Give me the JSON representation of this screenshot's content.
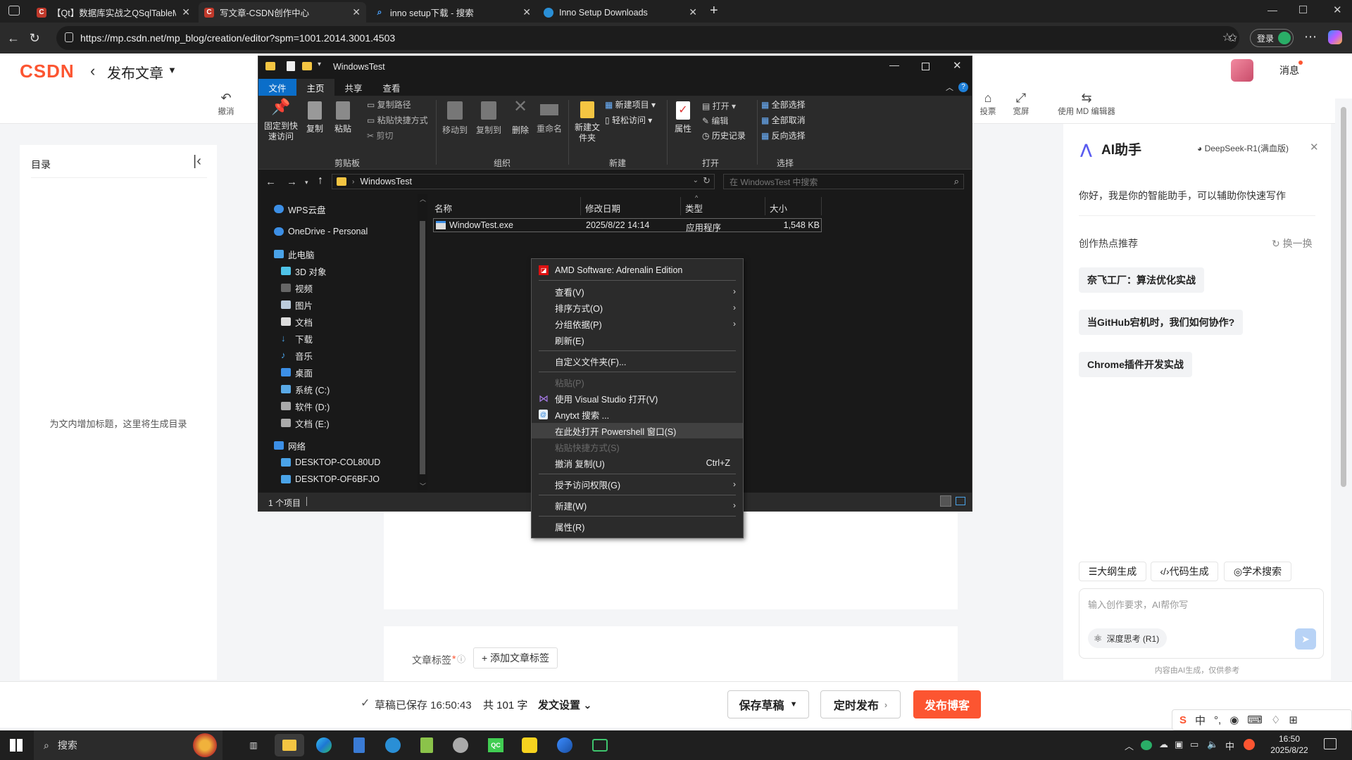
{
  "browser": {
    "tabs": [
      {
        "title": "【Qt】数据库实战之QSqlTableMc",
        "icon": "csdn-icon"
      },
      {
        "title": "写文章-CSDN创作中心",
        "icon": "csdn-icon"
      },
      {
        "title": "inno setup下载 - 搜索",
        "icon": "search-icon"
      },
      {
        "title": "Inno Setup Downloads",
        "icon": "edge-icon"
      }
    ],
    "url": "https://mp.csdn.net/mp_blog/creation/editor?spm=1001.2014.3001.4503",
    "login": "登录"
  },
  "csdn": {
    "logo": "CSDN",
    "title": "发布文章",
    "messages": "消息",
    "toolbar": [
      "撤消",
      "投票",
      "宽屏",
      "使用 MD 编辑器"
    ],
    "toc_title": "目录",
    "toc_placeholder": "为文内增加标题，这里将生成目录",
    "tags_label": "文章标签",
    "tags_star": "*",
    "add_tag": "+ 添加文章标签",
    "saved_status": "草稿已保存 16:50:43",
    "word_count": "共 101 字",
    "settings": "发文设置",
    "save_draft": "保存草稿",
    "schedule": "定时发布",
    "publish": "发布博客"
  },
  "ai": {
    "title": "AI助手",
    "model": "DeepSeek-R1(满血版)",
    "greeting": "你好，我是你的智能助手，可以辅助你快速写作",
    "hot_title": "创作热点推荐",
    "refresh": "换一换",
    "topics": [
      "奈飞工厂：算法优化实战",
      "当GitHub宕机时，我们如何协作?",
      "Chrome插件开发实战"
    ],
    "actions": [
      "大纲生成",
      "代码生成",
      "学术搜索"
    ],
    "input_placeholder": "输入创作要求，AI帮你写",
    "deep_think": "深度思考 (R1)",
    "disclaimer": "内容由AI生成，仅供参考"
  },
  "explorer": {
    "title": "WindowsTest",
    "tabs": [
      "文件",
      "主页",
      "共享",
      "查看"
    ],
    "ribbon": {
      "pin": "固定到快速访问",
      "copy": "复制",
      "paste": "粘贴",
      "copy_path": "复制路径",
      "paste_shortcut": "粘贴快捷方式",
      "cut": "剪切",
      "move_to": "移动到",
      "copy_to": "复制到",
      "delete": "删除",
      "rename": "重命名",
      "new_folder": "新建文件夹",
      "new_item": "新建项目",
      "easy_access": "轻松访问",
      "properties": "属性",
      "open": "打开",
      "edit": "编辑",
      "history": "历史记录",
      "select_all": "全部选择",
      "select_none": "全部取消",
      "invert": "反向选择",
      "groups": [
        "剪贴板",
        "组织",
        "新建",
        "打开",
        "选择"
      ]
    },
    "path": "WindowsTest",
    "search_placeholder": "在 WindowsTest 中搜索",
    "sidebar": [
      "WPS云盘",
      "OneDrive - Personal",
      "此电脑",
      "3D 对象",
      "视频",
      "图片",
      "文档",
      "下载",
      "音乐",
      "桌面",
      "系统 (C:)",
      "软件 (D:)",
      "文档 (E:)",
      "网络",
      "DESKTOP-COL80UD",
      "DESKTOP-OF6BFJO"
    ],
    "columns": [
      "名称",
      "修改日期",
      "类型",
      "大小"
    ],
    "files": [
      {
        "name": "WindowTest.exe",
        "date": "2025/8/22 14:14",
        "type": "应用程序",
        "size": "1,548 KB"
      }
    ],
    "status": "1 个项目"
  },
  "context_menu": [
    {
      "label": "AMD Software: Adrenalin Edition",
      "icon": "amd-icon"
    },
    {
      "label": "查看(V)",
      "arrow": true
    },
    {
      "label": "排序方式(O)",
      "arrow": true
    },
    {
      "label": "分组依据(P)",
      "arrow": true
    },
    {
      "label": "刷新(E)"
    },
    {
      "label": "自定义文件夹(F)..."
    },
    {
      "label": "粘贴(P)",
      "disabled": true
    },
    {
      "label": "使用 Visual Studio 打开(V)",
      "icon": "visual-studio-icon"
    },
    {
      "label": "Anytxt 搜索 ...",
      "icon": "anytxt-icon"
    },
    {
      "label": "在此处打开 Powershell 窗口(S)",
      "highlighted": true
    },
    {
      "label": "粘贴快捷方式(S)",
      "disabled": true
    },
    {
      "label": "撤消 复制(U)",
      "shortcut": "Ctrl+Z"
    },
    {
      "label": "授予访问权限(G)",
      "arrow": true
    },
    {
      "label": "新建(W)",
      "arrow": true
    },
    {
      "label": "属性(R)"
    }
  ],
  "taskbar": {
    "search": "搜索",
    "time": "16:50",
    "date": "2025/8/22",
    "ime": "中"
  },
  "colors": {
    "accent": "#fc5531",
    "explorer_blue": "#0b6ec9"
  }
}
